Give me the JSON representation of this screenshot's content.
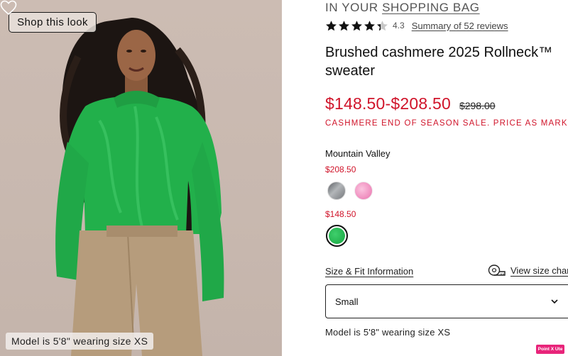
{
  "gallery": {
    "shop_look_label": "Shop this look",
    "model_caption": "Model is 5'8\" wearing size XS",
    "icons": {
      "favorite": "heart-outline-icon"
    }
  },
  "product": {
    "bag_prefix": "IN YOUR ",
    "bag_link": "SHOPPING BAG",
    "rating_value": "4.3",
    "rating_stars": 4.3,
    "reviews_link": "Summary of 52 reviews",
    "title": "Brushed cashmere 2025 Rollneck™ sweater",
    "price_range": "$148.50-$208.50",
    "original_price": "$298.00",
    "promo": "CASHMERE END OF SEASON SALE. PRICE AS MARKED.",
    "color_name": "Mountain Valley",
    "swatch_groups": [
      {
        "price": "$208.50",
        "swatches": [
          "grey-heather",
          "pink"
        ]
      },
      {
        "price": "$148.50",
        "swatches": [
          "green"
        ],
        "selected": "green"
      }
    ],
    "fit_link": "Size & Fit Information",
    "size_chart_link": "View size chart",
    "size_select": {
      "value": "Small"
    },
    "model_note": "Model is 5'8\" wearing size XS",
    "badge": "Point X Ute"
  },
  "colors": {
    "sale_red": "#d0142a",
    "sweater_green": "#1fae4a",
    "text": "#111111"
  }
}
